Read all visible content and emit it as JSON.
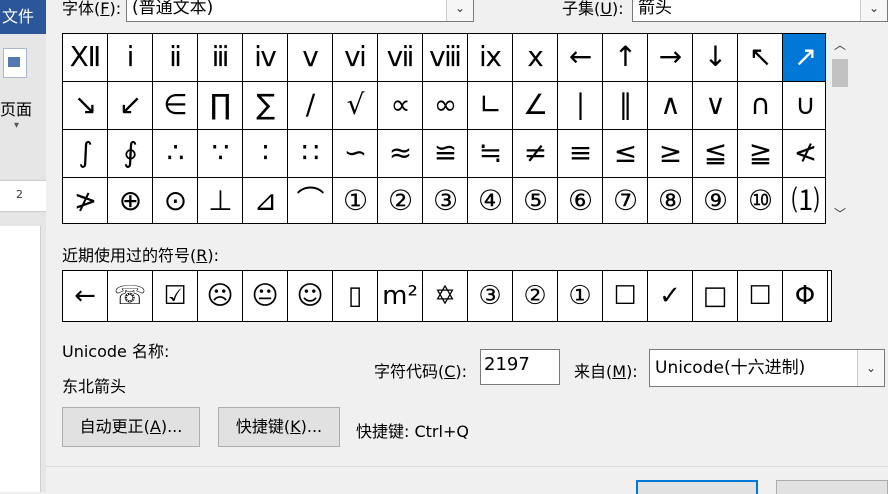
{
  "background_app": {
    "file_tab": "文件",
    "page_label": "页面",
    "ruler_number": "2"
  },
  "dialog": {
    "font_label": "字体(F):",
    "font_label_pre": "字体(",
    "font_label_key": "F",
    "font_label_post": "):",
    "font_value": "(普通文本)",
    "subset_label_pre": "子集(",
    "subset_label_key": "U",
    "subset_label_post": "):",
    "subset_value": "箭头",
    "symbols": [
      "Ⅻ",
      "ⅰ",
      "ⅱ",
      "ⅲ",
      "ⅳ",
      "ⅴ",
      "ⅵ",
      "ⅶ",
      "ⅷ",
      "ⅸ",
      "ⅹ",
      "←",
      "↑",
      "→",
      "↓",
      "↖",
      "↗",
      "↘",
      "↙",
      "∈",
      "∏",
      "∑",
      "∕",
      "√",
      "∝",
      "∞",
      "∟",
      "∠",
      "∣",
      "∥",
      "∧",
      "∨",
      "∩",
      "∪",
      "∫",
      "∮",
      "∴",
      "∵",
      "∶",
      "∷",
      "∽",
      "≈",
      "≌",
      "≒",
      "≠",
      "≡",
      "≤",
      "≥",
      "≦",
      "≧",
      "≮",
      "≯",
      "⊕",
      "⊙",
      "⊥",
      "⊿",
      "⌒",
      "①",
      "②",
      "③",
      "④",
      "⑤",
      "⑥",
      "⑦",
      "⑧",
      "⑨",
      "⑩",
      "⑴"
    ],
    "selected_index": 16,
    "recent_label_pre": "近期使用过的符号(",
    "recent_label_key": "R",
    "recent_label_post": "):",
    "recent_symbols": [
      "←",
      "☏",
      "☑",
      "☹",
      "😐",
      "☺",
      "▯",
      "m²",
      "✡",
      "③",
      "②",
      "①",
      "☐",
      "✓",
      "□",
      "☐",
      "Φ"
    ],
    "unicode_name_label": "Unicode 名称:",
    "unicode_name_value": "东北箭头",
    "char_code_label_pre": "字符代码(",
    "char_code_label_key": "C",
    "char_code_label_post": "):",
    "char_code_value": "2197",
    "from_label_pre": "来自(",
    "from_label_key": "M",
    "from_label_post": "):",
    "from_value": "Unicode(十六进制)",
    "autocorrect_pre": "自动更正(",
    "autocorrect_key": "A",
    "autocorrect_post": ")...",
    "shortcut_btn_pre": "快捷键(",
    "shortcut_btn_key": "K",
    "shortcut_btn_post": ")...",
    "shortcut_text": "快捷键: Ctrl+Q"
  }
}
